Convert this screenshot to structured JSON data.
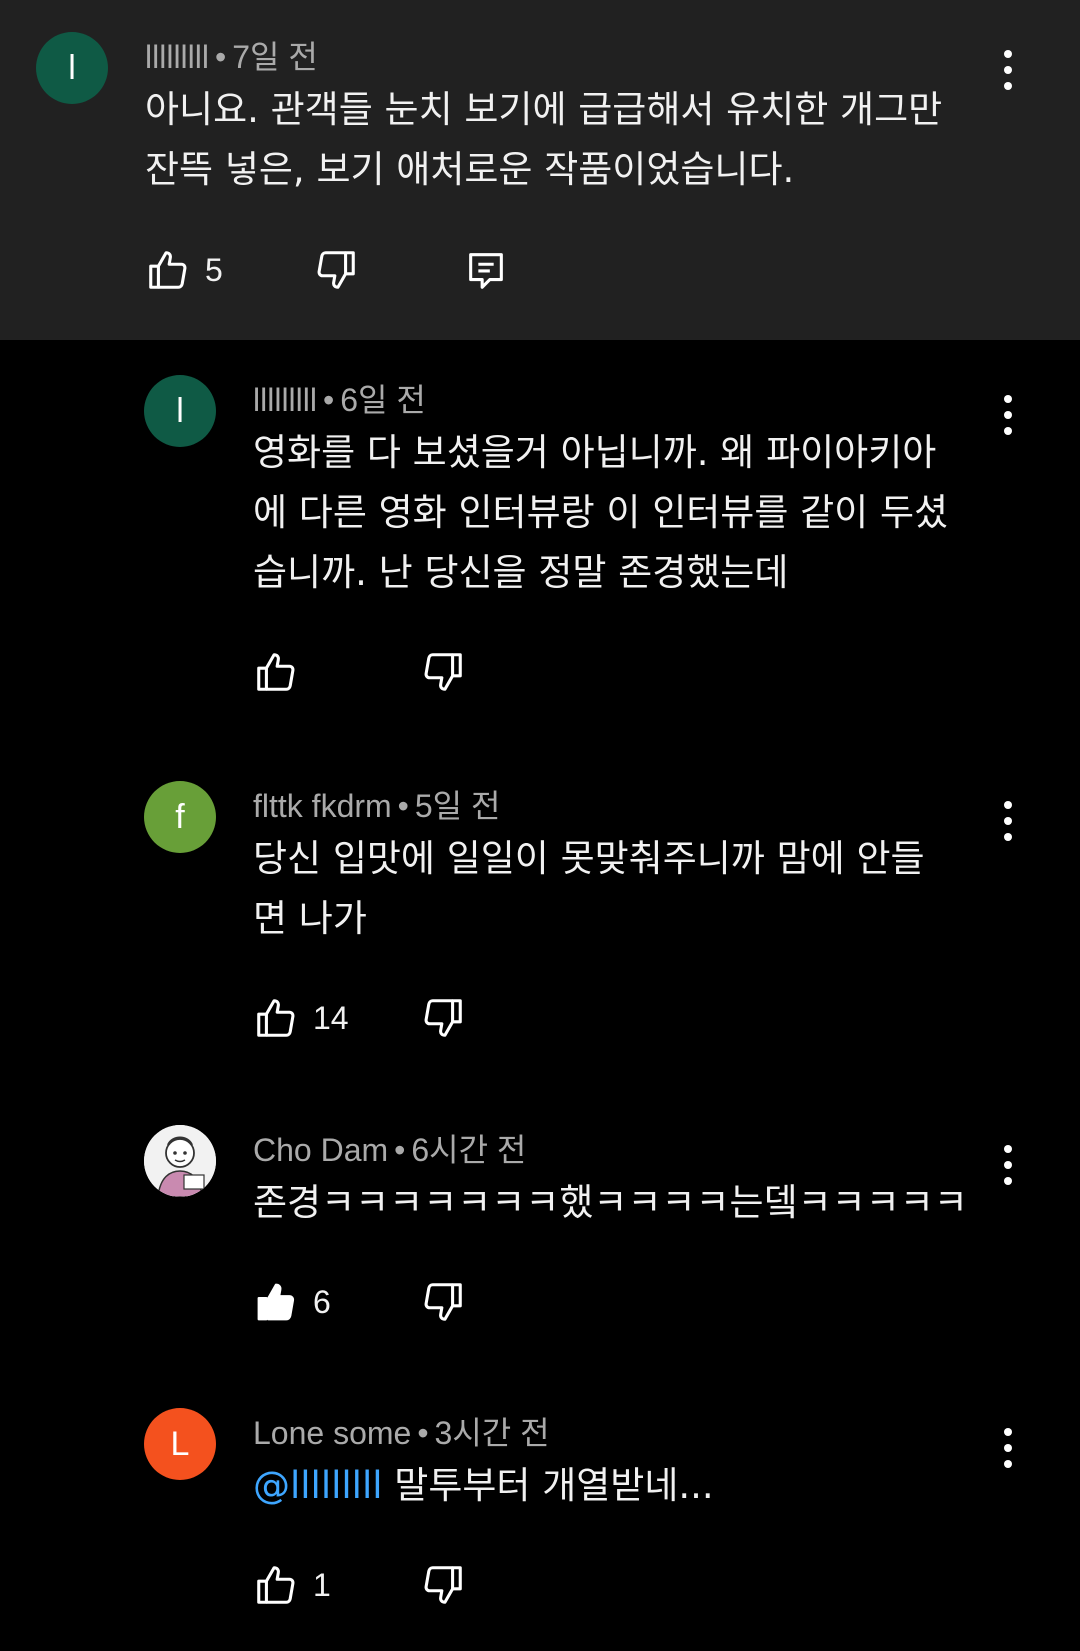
{
  "parent_comment": {
    "avatar_letter": "l",
    "avatar_color": "#0f5a45",
    "author": "lllllllll",
    "time": "7일 전",
    "text": "아니요. 관객들 눈치 보기에 급급해서 유치한 개그만\n잔뜩 넣은, 보기 애처로운 작품이었습니다.",
    "like_count": "5"
  },
  "replies": [
    {
      "avatar_letter": "l",
      "avatar_color": "#0f5a45",
      "author": "lllllllll",
      "time": "6일 전",
      "text": "영화를 다 보셨을거 아닙니까. 왜 파이아키아\n에 다른 영화 인터뷰랑 이 인터뷰를 같이 두셨\n습니까. 난 당신을 정말 존경했는데",
      "like_count": ""
    },
    {
      "avatar_letter": "f",
      "avatar_color": "#689f38",
      "author": "flttk fkdrm",
      "time": "5일 전",
      "text": "당신 입맛에 일일이 못맞춰주니까 맘에 안들\n면 나가",
      "like_count": "14"
    },
    {
      "avatar_letter": "",
      "avatar_color": "#e8e8e8",
      "author": "Cho Dam",
      "time": "6시간 전",
      "text": "존경ㅋㅋㅋㅋㅋㅋㅋ했ㅋㅋㅋㅋ는뎈ㅋㅋㅋㅋㅋ",
      "like_count": "6",
      "liked": true
    },
    {
      "avatar_letter": "L",
      "avatar_color": "#f4511e",
      "author": "Lone some",
      "time": "3시간 전",
      "mention": "@lllllllll",
      "text": " 말투부터 개열받네...",
      "like_count": "1"
    }
  ],
  "separator": "•",
  "icons": {
    "like": "thumb-up-icon",
    "dislike": "thumb-down-icon",
    "reply": "reply-icon",
    "more": "more-vert-icon"
  }
}
